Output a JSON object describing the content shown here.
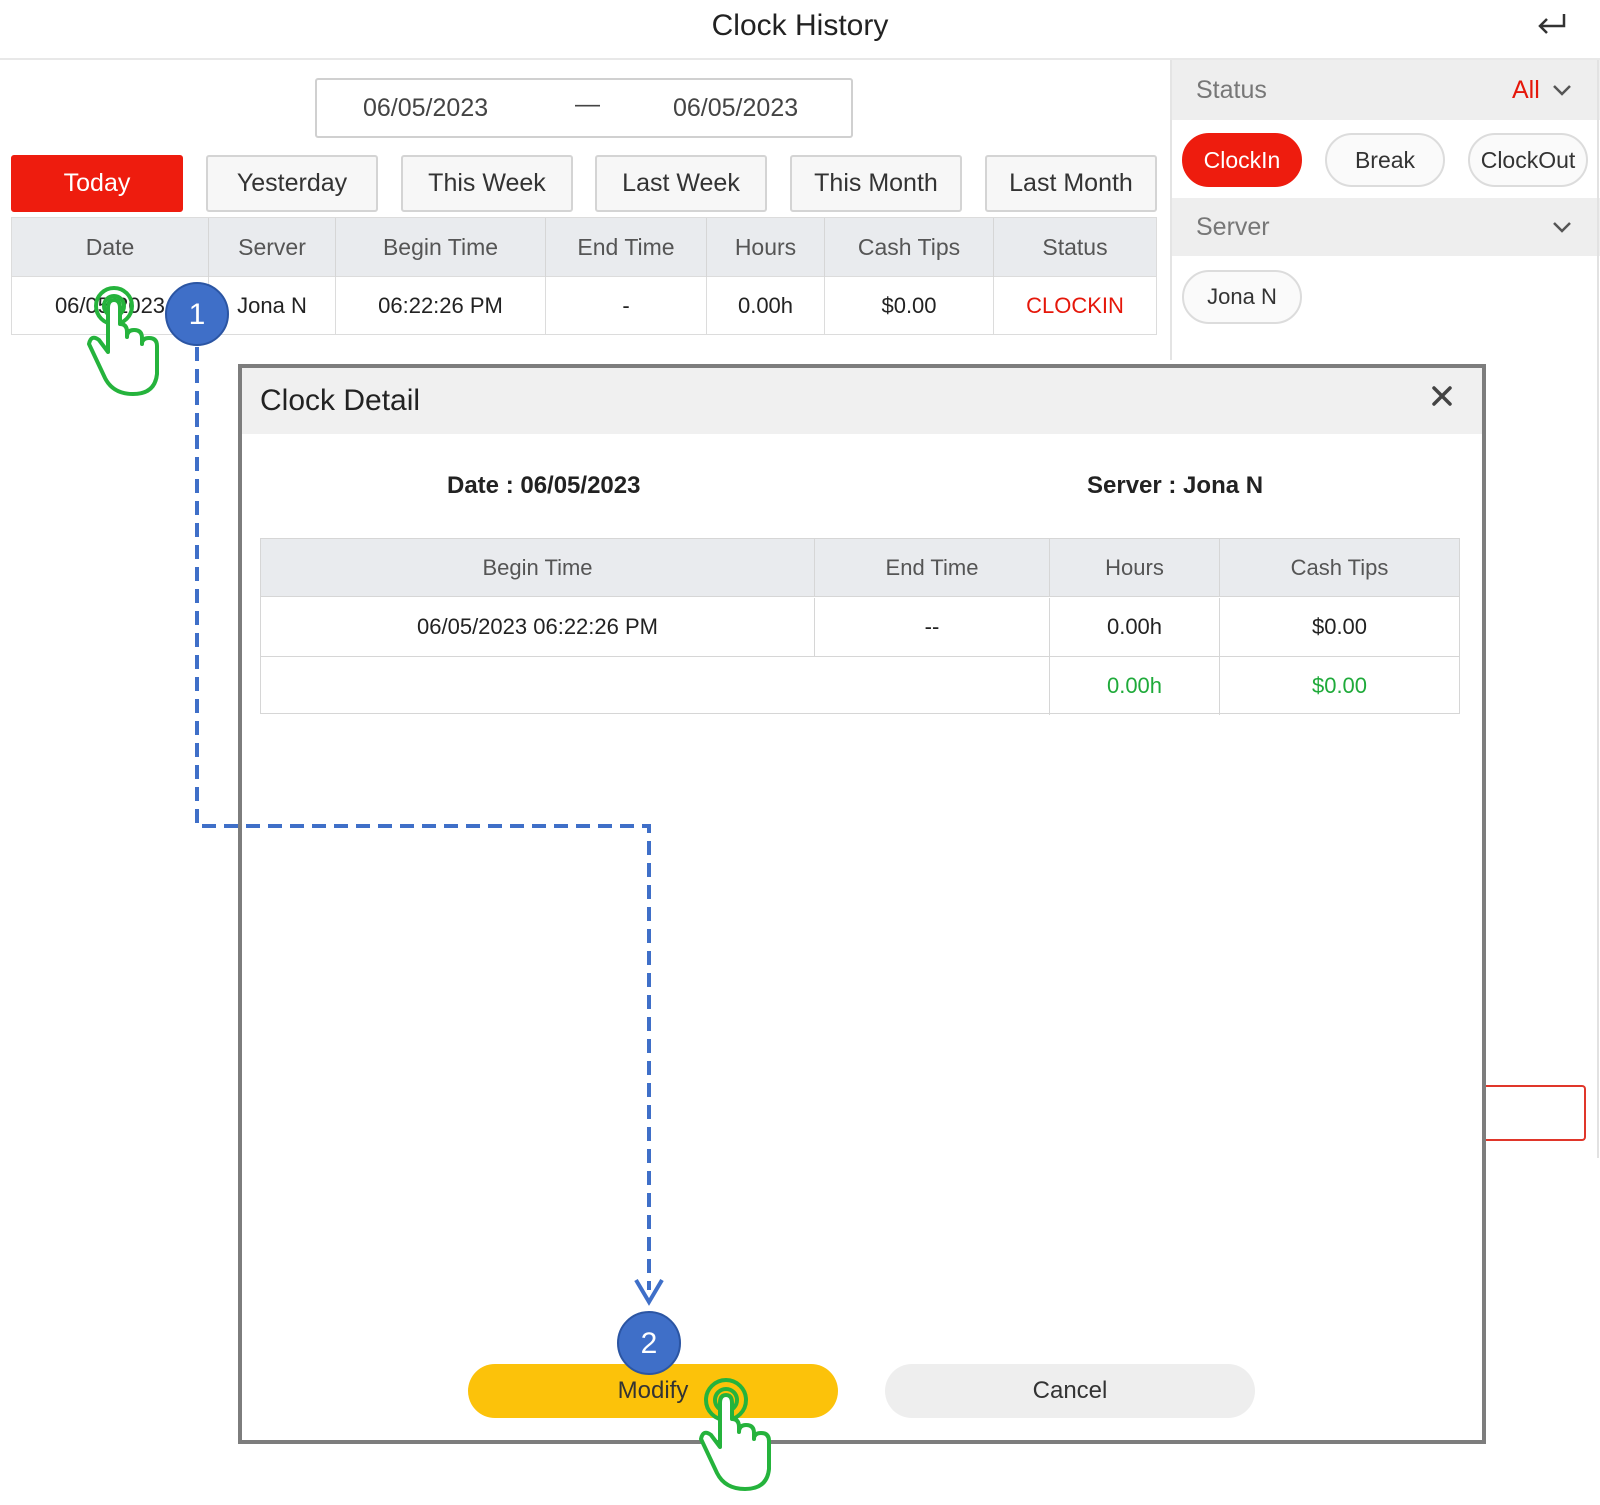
{
  "header": {
    "title": "Clock History",
    "back_icon": "return-arrow-icon"
  },
  "date_range": {
    "start": "06/05/2023",
    "separator": "—",
    "end": "06/05/2023"
  },
  "range_buttons": [
    {
      "label": "Today",
      "active": true
    },
    {
      "label": "Yesterday",
      "active": false
    },
    {
      "label": "This Week",
      "active": false
    },
    {
      "label": "Last Week",
      "active": false
    },
    {
      "label": "This Month",
      "active": false
    },
    {
      "label": "Last Month",
      "active": false
    }
  ],
  "table": {
    "columns": [
      "Date",
      "Server",
      "Begin Time",
      "End Time",
      "Hours",
      "Cash Tips",
      "Status"
    ],
    "rows": [
      {
        "date": "06/05/2023",
        "server": "Jona N",
        "begin": "06:22:26 PM",
        "end": "-",
        "hours": "0.00h",
        "tips": "$0.00",
        "status": "CLOCKIN"
      }
    ]
  },
  "filters": {
    "status_label": "Status",
    "status_value": "All",
    "status_chips": [
      {
        "label": "ClockIn",
        "active": true
      },
      {
        "label": "Break",
        "active": false
      },
      {
        "label": "ClockOut",
        "active": false
      }
    ],
    "server_label": "Server",
    "server_chips": [
      "Jona N"
    ]
  },
  "modal": {
    "title": "Clock Detail",
    "close_icon": "close-x-icon",
    "date_text": "Date : 06/05/2023",
    "server_text": "Server : Jona N",
    "columns": [
      "Begin Time",
      "End Time",
      "Hours",
      "Cash Tips"
    ],
    "row": {
      "begin": "06/05/2023 06:22:26 PM",
      "end": "--",
      "hours": "0.00h",
      "tips": "$0.00"
    },
    "totals": {
      "hours": "0.00h",
      "tips": "$0.00"
    },
    "modify_label": "Modify",
    "cancel_label": "Cancel"
  },
  "annotations": {
    "step1": "1",
    "step2": "2"
  },
  "colors": {
    "accent_red": "#ee1c0e",
    "modify_yellow": "#fcc20a",
    "total_green": "#1faa3a",
    "step_blue": "#3f6fc8"
  }
}
